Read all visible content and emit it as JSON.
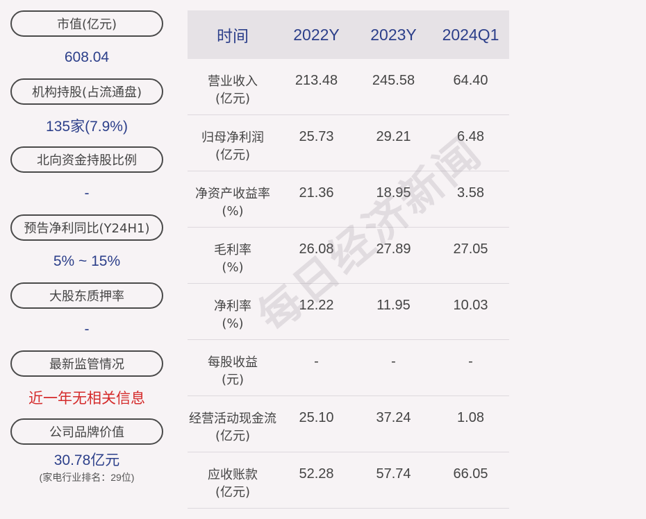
{
  "sidebar": {
    "items": [
      {
        "label": "市值(亿元)",
        "value": "608.04"
      },
      {
        "label": "机构持股(占流通盘)",
        "value": "135家(7.9%)"
      },
      {
        "label": "北向资金持股比例",
        "value": "-"
      },
      {
        "label": "预告净利同比(Y24H1)",
        "value": "5% ~ 15%"
      },
      {
        "label": "大股东质押率",
        "value": "-"
      },
      {
        "label": "最新监管情况",
        "value": "近一年无相关信息"
      },
      {
        "label": "公司品牌价值",
        "value": "30.78亿元",
        "note": "(家电行业排名：29位)"
      }
    ],
    "highlight_color": "#d42a2a",
    "value_color": "#2c3f8a"
  },
  "table": {
    "headers": [
      "时间",
      "2022Y",
      "2023Y",
      "2024Q1"
    ],
    "rows": [
      {
        "name": "营业收入",
        "unit": "(亿元)",
        "values": [
          "213.48",
          "245.58",
          "64.40"
        ]
      },
      {
        "name": "归母净利润",
        "unit": "(亿元)",
        "values": [
          "25.73",
          "29.21",
          "6.48"
        ]
      },
      {
        "name": "净资产收益率",
        "unit": "(%)",
        "values": [
          "21.36",
          "18.95",
          "3.58"
        ]
      },
      {
        "name": "毛利率",
        "unit": "(%)",
        "values": [
          "26.08",
          "27.89",
          "27.05"
        ]
      },
      {
        "name": "净利率",
        "unit": "(%)",
        "values": [
          "12.22",
          "11.95",
          "10.03"
        ]
      },
      {
        "name": "每股收益",
        "unit": "(元)",
        "values": [
          "-",
          "-",
          "-"
        ]
      },
      {
        "name": "经营活动现金流",
        "unit": "(亿元)",
        "values": [
          "25.10",
          "37.24",
          "1.08"
        ]
      },
      {
        "name": "应收账款",
        "unit": "(亿元)",
        "values": [
          "52.28",
          "57.74",
          "66.05"
        ]
      }
    ]
  },
  "watermark": "每日经济新闻"
}
